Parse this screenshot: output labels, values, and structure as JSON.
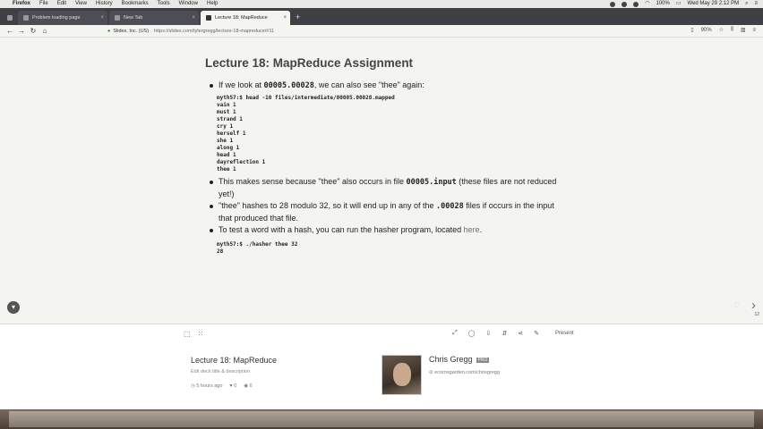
{
  "menubar": {
    "app": "Firefox",
    "menus": [
      "File",
      "Edit",
      "View",
      "History",
      "Bookmarks",
      "Tools",
      "Window",
      "Help"
    ],
    "battery": "100%",
    "clock": "Wed May 29  2:12 PM"
  },
  "tabs": [
    {
      "label": "Problem loading page"
    },
    {
      "label": "New Tab"
    },
    {
      "label": "Lecture 18: MapReduce"
    }
  ],
  "nav": {
    "site": "Slides, Inc. (US)",
    "url": "https://slides.com/tylergregg/lecture-18-mapreduce#/11",
    "zoom": "90%"
  },
  "slide": {
    "title": "Lecture 18: MapReduce Assignment",
    "bullet1_prefix": "If we look at ",
    "bullet1_code": "00005.00028",
    "bullet1_suffix": ", we can also see \"thee\" again:",
    "code1": [
      "myth57:$ head -10 files/intermediate/00005.00028.mapped",
      "vain 1",
      "must 1",
      "strand 1",
      "cry 1",
      "herself 1",
      "she 1",
      "along 1",
      "head 1",
      "dayreflection 1",
      "thee 1"
    ],
    "bullet2_prefix": "This makes sense because \"thee\" also occurs in file ",
    "bullet2_code": "00005.input",
    "bullet2_suffix": " (these files are not reduced yet!)",
    "bullet3_prefix": "\"thee\" hashes to 28 modulo 32, so it will end up in any of the ",
    "bullet3_code": ".00028",
    "bullet3_suffix": " files if occurs in the input that produced that file.",
    "bullet4_prefix": "To test a word with a hash, you can run the hasher program, located ",
    "bullet4_link": "here",
    "bullet4_suffix": ".",
    "code2": [
      "myth57:$ ./hasher thee 32",
      "28"
    ],
    "slide_number": "12"
  },
  "panel": {
    "present_label": "Present",
    "deck_title": "Lecture 18: MapReduce",
    "deck_edit": "Edit deck title & description",
    "time_ago": "5 hours ago",
    "likes": "0",
    "views": "6",
    "author_name": "Chris Gregg",
    "author_badge": "PRO",
    "author_link": "ecornsgarden.com/chrisgregg"
  }
}
